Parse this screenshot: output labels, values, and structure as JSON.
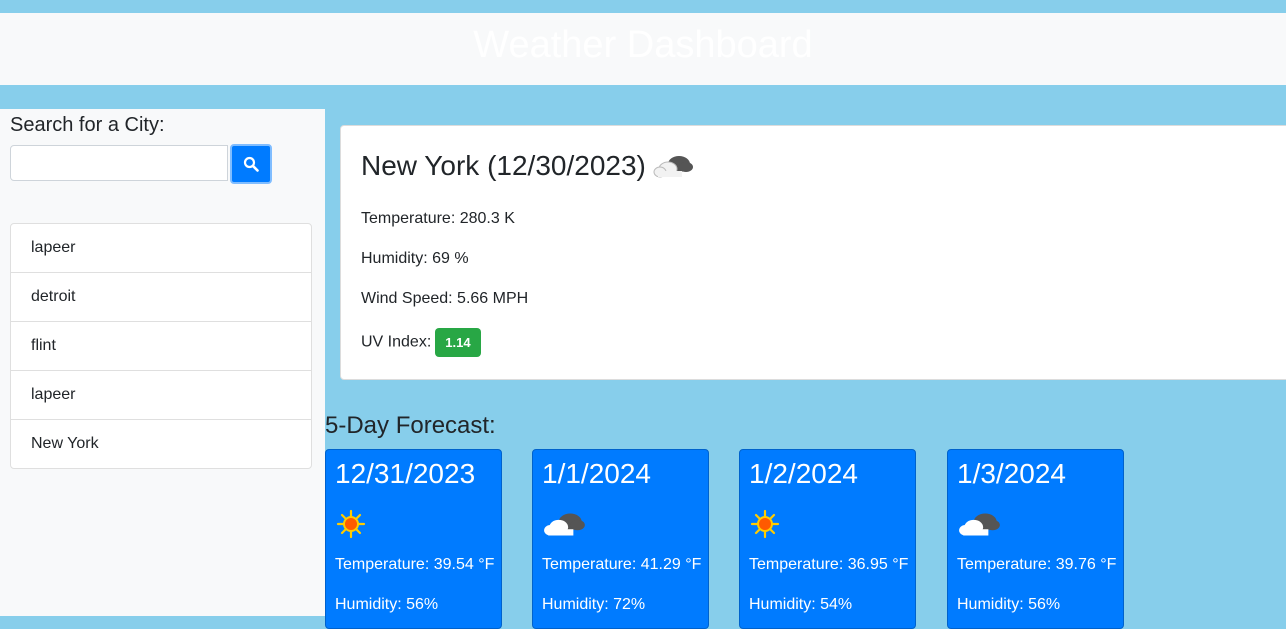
{
  "header": {
    "title": "Weather Dashboard"
  },
  "search": {
    "label": "Search for a City:",
    "value": "",
    "placeholder": "",
    "button_icon": "search-icon"
  },
  "history": [
    {
      "label": "lapeer"
    },
    {
      "label": "detroit"
    },
    {
      "label": "flint"
    },
    {
      "label": "lapeer"
    },
    {
      "label": "New York"
    }
  ],
  "current": {
    "title": "New York (12/30/2023)",
    "icon": "cloud-icon",
    "temperature": "Temperature: 280.3 K",
    "humidity": "Humidity: 69 %",
    "wind": "Wind Speed: 5.66 MPH",
    "uv_label": "UV Index:",
    "uv_value": "1.14",
    "uv_color": "#28a745"
  },
  "forecast": {
    "title": "5-Day Forecast:",
    "days": [
      {
        "date": "12/31/2023",
        "icon": "sun-icon",
        "temp": "Temperature: 39.54 °F",
        "humidity": "Humidity: 56%"
      },
      {
        "date": "1/1/2024",
        "icon": "cloud-icon",
        "temp": "Temperature: 41.29 °F",
        "humidity": "Humidity: 72%"
      },
      {
        "date": "1/2/2024",
        "icon": "sun-icon",
        "temp": "Temperature: 36.95 °F",
        "humidity": "Humidity: 54%"
      },
      {
        "date": "1/3/2024",
        "icon": "cloud-icon",
        "temp": "Temperature: 39.76 °F",
        "humidity": "Humidity: 56%"
      }
    ]
  },
  "colors": {
    "accent": "#007bff",
    "background": "#87ceeb",
    "panel": "#f8f9fa"
  }
}
